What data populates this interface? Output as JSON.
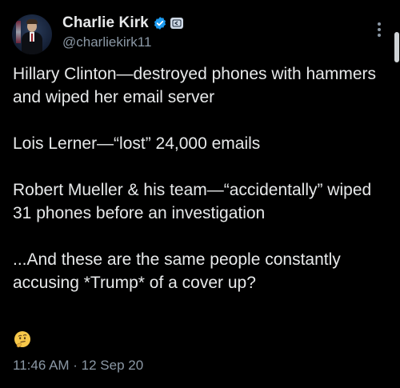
{
  "author": {
    "display_name": "Charlie Kirk",
    "handle": "@charliekirk11",
    "verified": true,
    "affiliation_badge_icon": "affiliation-badge-icon"
  },
  "tweet": {
    "paragraphs": [
      "Hillary Clinton—destroyed phones with hammers and wiped her email server",
      "Lois Lerner—“lost” 24,000 emails",
      "Robert Mueller & his team—“accidentally” wiped 31 phones before an investigation",
      "...And these are the same people constantly accusing *Trump* of a cover up?"
    ],
    "emoji": "thinking-face-emoji",
    "timestamp": "11:46 AM · 12 Sep 20"
  },
  "colors": {
    "background": "#000000",
    "text_primary": "#e7e9ea",
    "text_secondary": "#8b98a5",
    "verified_blue": "#1d9bf0"
  }
}
